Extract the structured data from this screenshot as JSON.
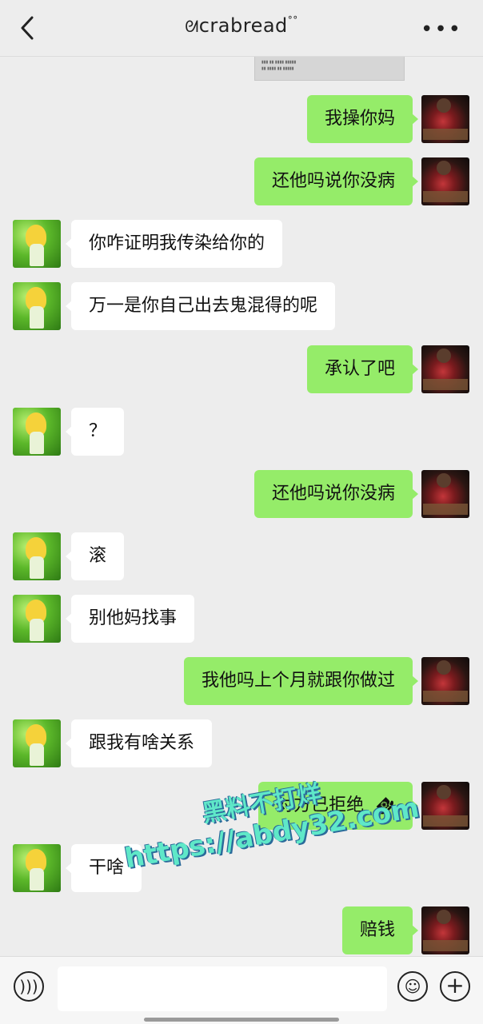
{
  "header": {
    "title": "crabread"
  },
  "chat": {
    "messages": [
      {
        "side": "out",
        "text": "我操你妈"
      },
      {
        "side": "out",
        "text": "还他吗说你没病"
      },
      {
        "side": "in",
        "text": "你咋证明我传染给你的"
      },
      {
        "side": "in",
        "text": "万一是你自己出去鬼混得的呢"
      },
      {
        "side": "out",
        "text": "承认了吧"
      },
      {
        "side": "in",
        "text": "？"
      },
      {
        "side": "out",
        "text": "还他吗说你没病"
      },
      {
        "side": "in",
        "text": "滚"
      },
      {
        "side": "in",
        "text": "别他妈找事"
      },
      {
        "side": "out",
        "text": "我他吗上个月就跟你做过"
      },
      {
        "side": "in",
        "text": "跟我有啥关系"
      },
      {
        "side": "out",
        "text": "对方已拒绝"
      },
      {
        "side": "in",
        "text": "干啥"
      },
      {
        "side": "out",
        "text": "赔钱"
      }
    ]
  },
  "watermark": {
    "line1": "黑料不打烊",
    "line2": "https://abdy32.com"
  },
  "icons": {
    "back": "chevron-left-icon",
    "more": "more-dots-icon",
    "voice": "voice-icon",
    "emoji": "emoji-icon",
    "plus": "plus-icon",
    "call": "phone-hangup-icon"
  },
  "colors": {
    "outgoing_bubble": "#95ec69",
    "incoming_bubble": "#ffffff",
    "background": "#ededed"
  }
}
